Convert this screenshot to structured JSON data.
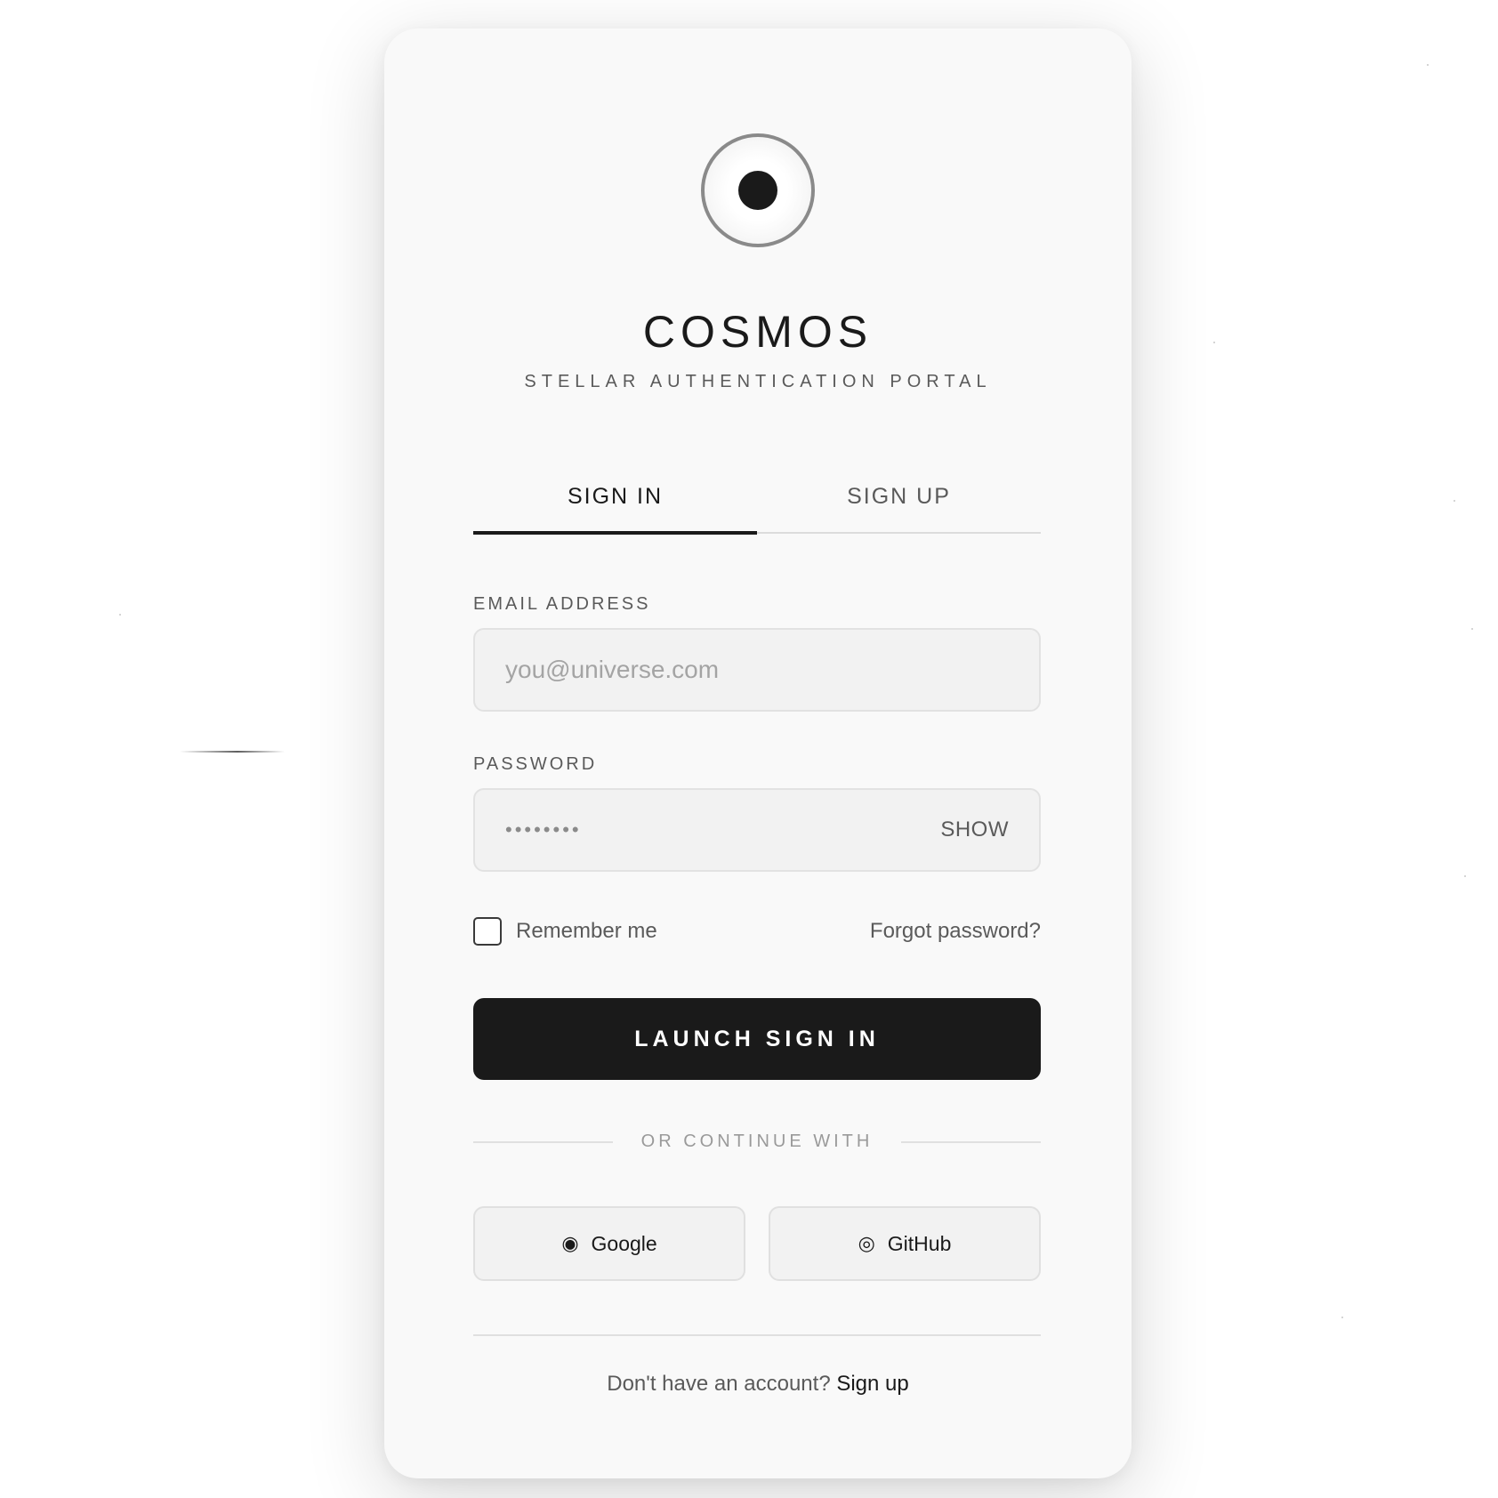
{
  "brand": {
    "name": "COSMOS",
    "tagline": "STELLAR AUTHENTICATION PORTAL",
    "logo_icon": "orbit-eye-icon"
  },
  "tabs": [
    {
      "label": "SIGN IN",
      "active": true
    },
    {
      "label": "SIGN UP",
      "active": false
    }
  ],
  "form": {
    "email": {
      "label": "EMAIL ADDRESS",
      "placeholder": "you@universe.com",
      "value": ""
    },
    "password": {
      "label": "PASSWORD",
      "masked_value": "••••••••",
      "toggle_label": "SHOW"
    },
    "remember": {
      "label": "Remember me",
      "checked": false
    },
    "forgot_label": "Forgot password?",
    "submit_label": "LAUNCH SIGN IN"
  },
  "divider_label": "OR CONTINUE WITH",
  "social": {
    "google": {
      "label": "Google",
      "icon": "◉"
    },
    "github": {
      "label": "GitHub",
      "icon": "◎"
    }
  },
  "footer": {
    "prompt": "Don't have an account?",
    "link_label": "Sign up"
  },
  "colors": {
    "accent": "#1a1a1a",
    "card_background": "#f9f9f9",
    "field_background": "#f2f2f2",
    "muted_text": "#5a5a5a"
  }
}
